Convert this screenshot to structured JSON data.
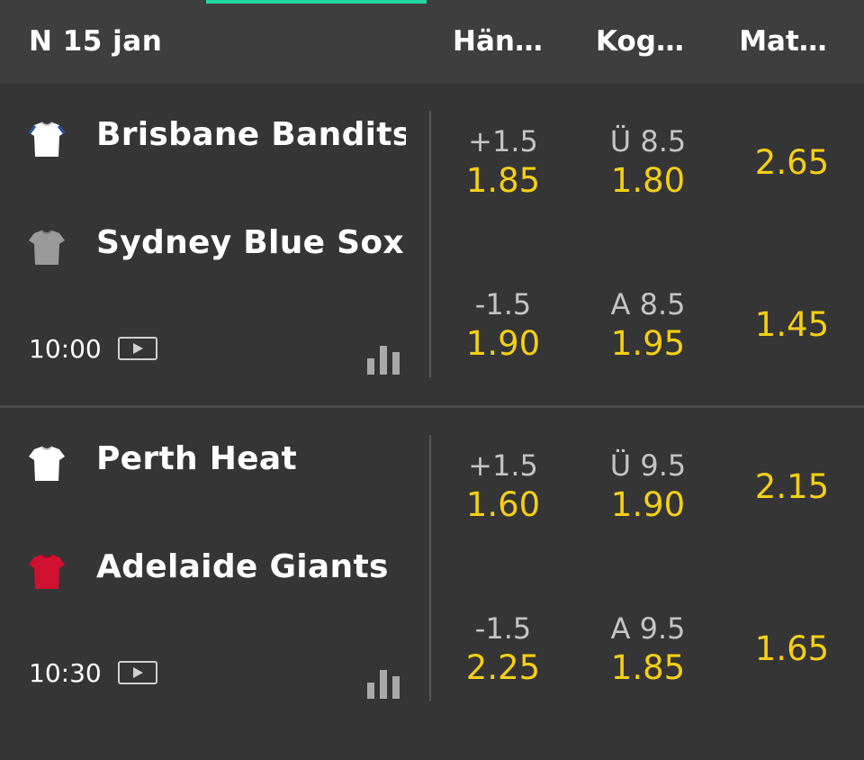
{
  "header": {
    "date": "N 15 jan",
    "columns": [
      "Hän…",
      "Kog…",
      "Mat…"
    ]
  },
  "matches": [
    {
      "home": {
        "name": "Brisbane Bandits",
        "shirt_color": "#ffffff",
        "shirt_trim": "#1f4fa8"
      },
      "away": {
        "name": "Sydney Blue Sox",
        "shirt_color": "#9a9a9a",
        "shirt_trim": "#9a9a9a"
      },
      "time": "10:00",
      "handicap": [
        {
          "line": "+1.5",
          "price": "1.85"
        },
        {
          "line": "-1.5",
          "price": "1.90"
        }
      ],
      "total": [
        {
          "line": "Ü 8.5",
          "price": "1.80"
        },
        {
          "line": "A 8.5",
          "price": "1.95"
        }
      ],
      "match_odds": [
        "2.65",
        "1.45"
      ]
    },
    {
      "home": {
        "name": "Perth Heat",
        "shirt_color": "#ffffff",
        "shirt_trim": "#dddddd"
      },
      "away": {
        "name": "Adelaide Giants",
        "shirt_color": "#d0102f",
        "shirt_trim": "#d0102f"
      },
      "time": "10:30",
      "handicap": [
        {
          "line": "+1.5",
          "price": "1.60"
        },
        {
          "line": "-1.5",
          "price": "2.25"
        }
      ],
      "total": [
        {
          "line": "Ü 9.5",
          "price": "1.90"
        },
        {
          "line": "A 9.5",
          "price": "1.85"
        }
      ],
      "match_odds": [
        "2.15",
        "1.65"
      ]
    }
  ],
  "colors": {
    "accent": "#21d6a2",
    "odds": "#f5cf14",
    "background": "#353535",
    "header_background": "#3e3e3e"
  },
  "icons": [
    "shirt-icon",
    "play-video-icon",
    "statistics-icon"
  ]
}
